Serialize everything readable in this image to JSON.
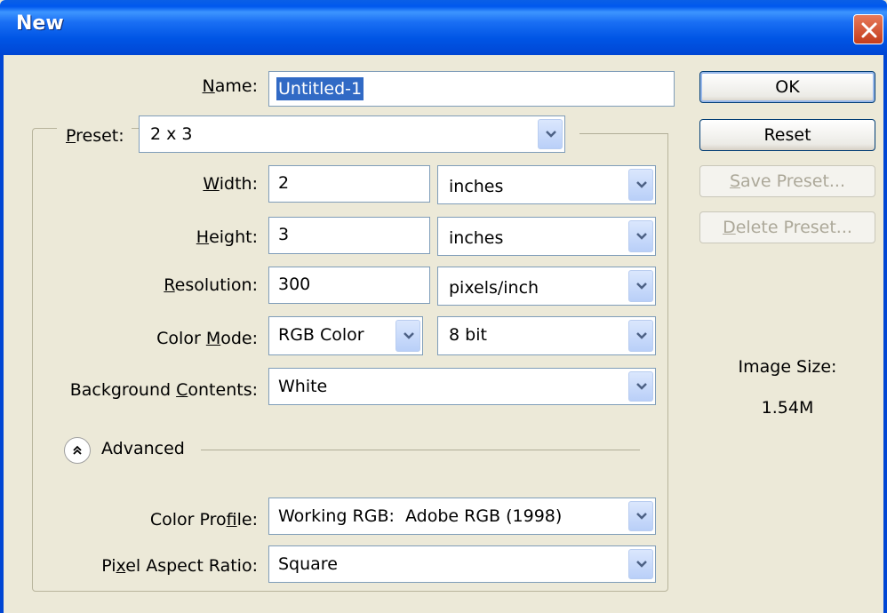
{
  "window": {
    "title": "New"
  },
  "name": {
    "label_pre": "",
    "label_u": "N",
    "label_post": "ame:",
    "value": "Untitled-1"
  },
  "preset": {
    "label_u": "P",
    "label_post": "reset:",
    "value": "2 x 3"
  },
  "width": {
    "label_u": "W",
    "label_post": "idth:",
    "value": "2",
    "unit": "inches"
  },
  "height": {
    "label_u": "H",
    "label_post": "eight:",
    "value": "3",
    "unit": "inches"
  },
  "resolution": {
    "label_u": "R",
    "label_post": "esolution:",
    "value": "300",
    "unit": "pixels/inch"
  },
  "color_mode": {
    "label_pre": "Color ",
    "label_u": "M",
    "label_post": "ode:",
    "value": "RGB Color",
    "depth": "8 bit"
  },
  "background": {
    "label_pre": "Background ",
    "label_u": "C",
    "label_post": "ontents:",
    "value": "White"
  },
  "advanced": {
    "label": "Advanced"
  },
  "color_profile": {
    "label_pre": "Color Pro",
    "label_u": "f",
    "label_post": "ile:",
    "value": "Working RGB:  Adobe RGB (1998)"
  },
  "pixel_aspect": {
    "label_pre": "Pi",
    "label_u": "x",
    "label_post": "el Aspect Ratio:",
    "value": "Square"
  },
  "buttons": {
    "ok": "OK",
    "reset": "Reset",
    "save_u": "S",
    "save_post": "ave Preset...",
    "delete_u": "D",
    "delete_post": "elete Preset..."
  },
  "image_size": {
    "label": "Image Size:",
    "value": "1.54M"
  },
  "colors": {
    "titlebar": "#0055e5",
    "dialog_bg": "#ece9d8",
    "selection": "#316ac5"
  }
}
